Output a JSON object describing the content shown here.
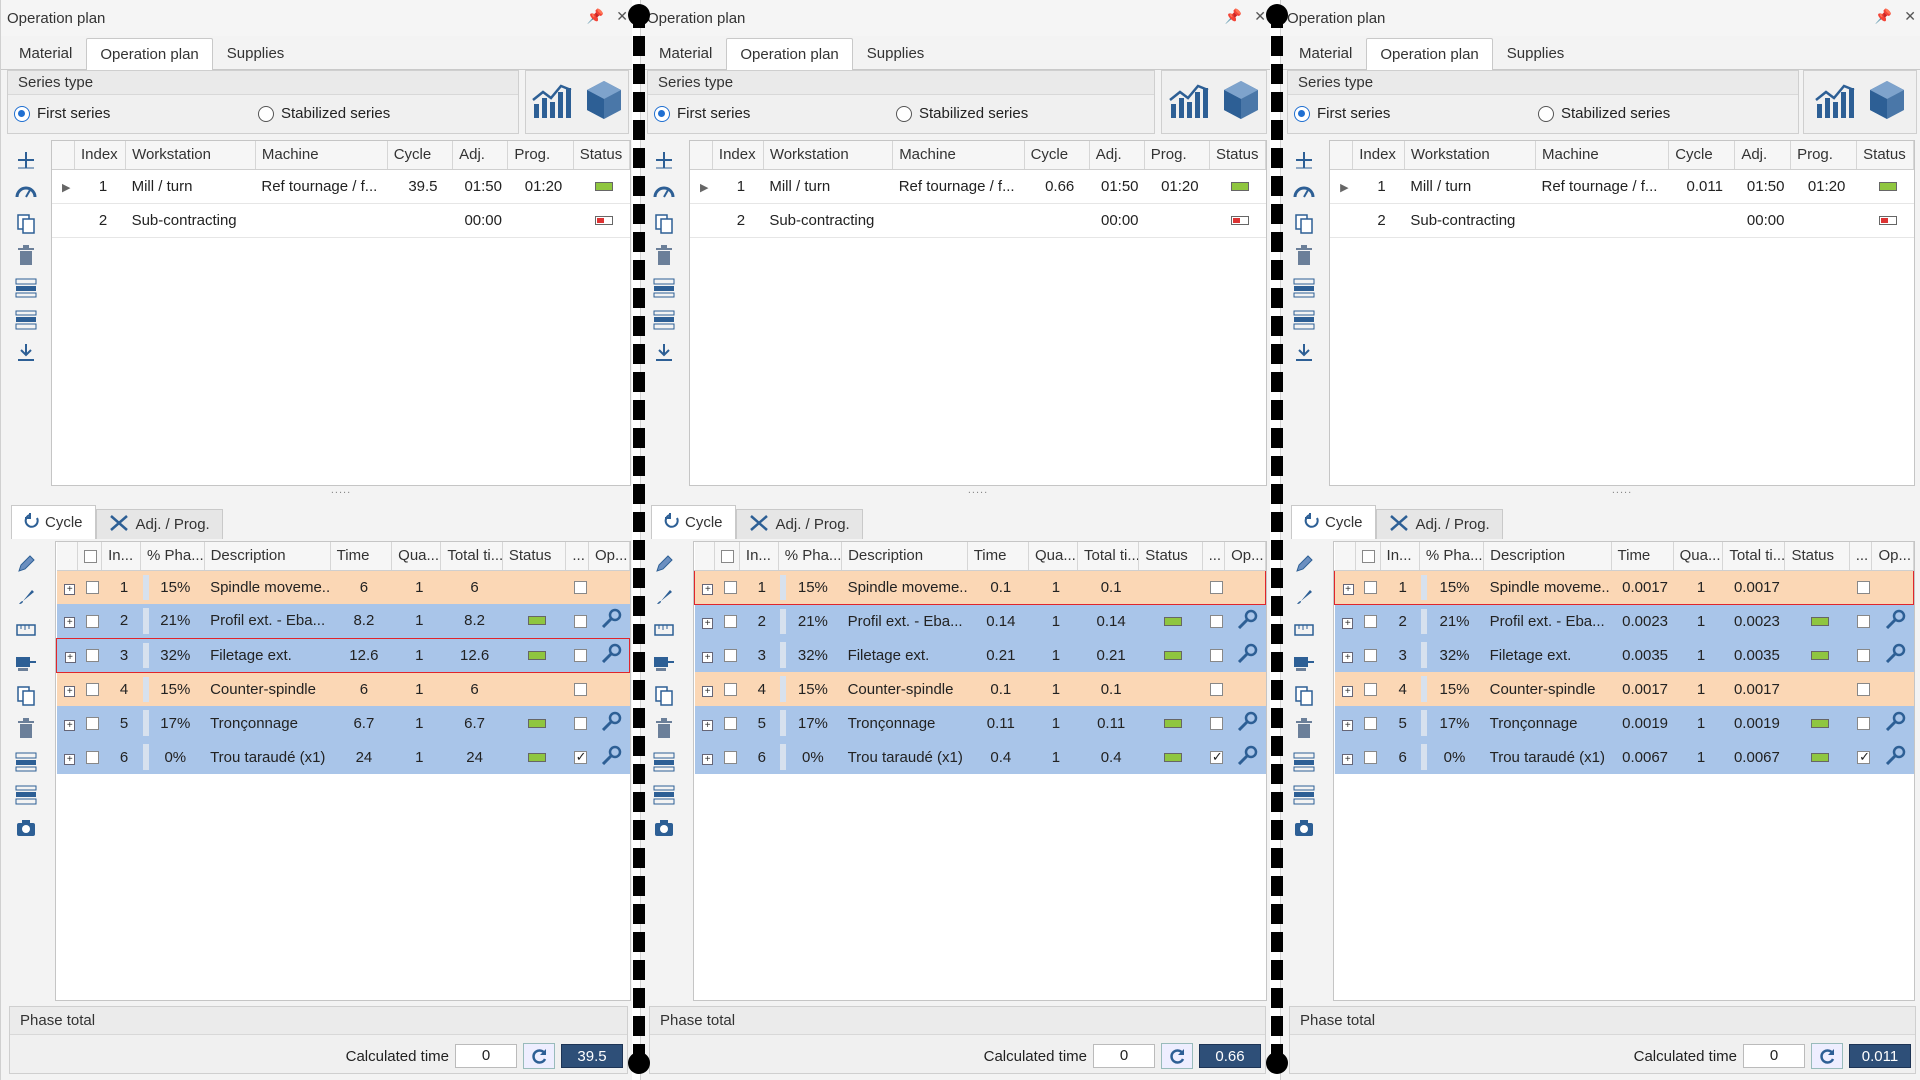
{
  "panels": [
    {
      "title": "Operation plan",
      "tabs": [
        "Material",
        "Operation plan",
        "Supplies"
      ],
      "active_tab": 1,
      "series_type": {
        "caption": "Series type",
        "options": [
          "First series",
          "Stabilized series"
        ],
        "selected": 0
      },
      "ops_columns": [
        "Index",
        "Workstation",
        "Machine",
        "Cycle",
        "Adj.",
        "Prog.",
        "Status"
      ],
      "ops_rows": [
        {
          "index": "1",
          "workstation": "Mill / turn",
          "machine": "Ref tournage / f...",
          "cycle": "39.5",
          "adj": "01:50",
          "prog": "01:20",
          "status": "green"
        },
        {
          "index": "2",
          "workstation": "Sub-contracting",
          "machine": "",
          "cycle": "",
          "adj": "00:00",
          "prog": "",
          "status": "red"
        }
      ],
      "sub_tabs": [
        "Cycle",
        "Adj. / Prog."
      ],
      "phase_columns": [
        "In...",
        "% Pha...",
        "Description",
        "Time",
        "Qua...",
        "Total ti...",
        "Status",
        "...",
        "Op..."
      ],
      "phase_rows": [
        {
          "index": "1",
          "pct": "15%",
          "desc": "Spindle moveme...",
          "time": "6",
          "qty": "1",
          "total": "6",
          "color": "orange",
          "status": "",
          "checked": false,
          "op": false,
          "selected": false
        },
        {
          "index": "2",
          "pct": "21%",
          "desc": "Profil ext. - Eba...",
          "time": "8.2",
          "qty": "1",
          "total": "8.2",
          "color": "blue",
          "status": "green",
          "checked": false,
          "op": true,
          "selected": false
        },
        {
          "index": "3",
          "pct": "32%",
          "desc": "Filetage ext.",
          "time": "12.6",
          "qty": "1",
          "total": "12.6",
          "color": "blue",
          "status": "green",
          "checked": false,
          "op": true,
          "selected": true
        },
        {
          "index": "4",
          "pct": "15%",
          "desc": "Counter-spindle",
          "time": "6",
          "qty": "1",
          "total": "6",
          "color": "orange",
          "status": "",
          "checked": false,
          "op": false,
          "selected": false
        },
        {
          "index": "5",
          "pct": "17%",
          "desc": "Tronçonnage",
          "time": "6.7",
          "qty": "1",
          "total": "6.7",
          "color": "blue",
          "status": "green",
          "checked": false,
          "op": true,
          "selected": false
        },
        {
          "index": "6",
          "pct": "0%",
          "desc": "Trou taraudé (x1)",
          "time": "24",
          "qty": "1",
          "total": "24",
          "color": "blue",
          "status": "green",
          "checked": true,
          "op": true,
          "selected": false
        }
      ],
      "footer": {
        "caption": "Phase total",
        "calc_label": "Calculated time",
        "calc_input": "0",
        "calc_result": "39.5"
      }
    },
    {
      "title": "Operation plan",
      "tabs": [
        "Material",
        "Operation plan",
        "Supplies"
      ],
      "active_tab": 1,
      "series_type": {
        "caption": "Series type",
        "options": [
          "First series",
          "Stabilized series"
        ],
        "selected": 0
      },
      "ops_columns": [
        "Index",
        "Workstation",
        "Machine",
        "Cycle",
        "Adj.",
        "Prog.",
        "Status"
      ],
      "ops_rows": [
        {
          "index": "1",
          "workstation": "Mill / turn",
          "machine": "Ref tournage / f...",
          "cycle": "0.66",
          "adj": "01:50",
          "prog": "01:20",
          "status": "green"
        },
        {
          "index": "2",
          "workstation": "Sub-contracting",
          "machine": "",
          "cycle": "",
          "adj": "00:00",
          "prog": "",
          "status": "red"
        }
      ],
      "sub_tabs": [
        "Cycle",
        "Adj. / Prog."
      ],
      "phase_columns": [
        "In...",
        "% Pha...",
        "Description",
        "Time",
        "Qua...",
        "Total ti...",
        "Status",
        "...",
        "Op..."
      ],
      "phase_rows": [
        {
          "index": "1",
          "pct": "15%",
          "desc": "Spindle moveme...",
          "time": "0.1",
          "qty": "1",
          "total": "0.1",
          "color": "orange",
          "status": "",
          "checked": false,
          "op": false,
          "selected": true
        },
        {
          "index": "2",
          "pct": "21%",
          "desc": "Profil ext. - Eba...",
          "time": "0.14",
          "qty": "1",
          "total": "0.14",
          "color": "blue",
          "status": "green",
          "checked": false,
          "op": true,
          "selected": false
        },
        {
          "index": "3",
          "pct": "32%",
          "desc": "Filetage ext.",
          "time": "0.21",
          "qty": "1",
          "total": "0.21",
          "color": "blue",
          "status": "green",
          "checked": false,
          "op": true,
          "selected": false
        },
        {
          "index": "4",
          "pct": "15%",
          "desc": "Counter-spindle",
          "time": "0.1",
          "qty": "1",
          "total": "0.1",
          "color": "orange",
          "status": "",
          "checked": false,
          "op": false,
          "selected": false
        },
        {
          "index": "5",
          "pct": "17%",
          "desc": "Tronçonnage",
          "time": "0.11",
          "qty": "1",
          "total": "0.11",
          "color": "blue",
          "status": "green",
          "checked": false,
          "op": true,
          "selected": false
        },
        {
          "index": "6",
          "pct": "0%",
          "desc": "Trou taraudé (x1)",
          "time": "0.4",
          "qty": "1",
          "total": "0.4",
          "color": "blue",
          "status": "green",
          "checked": true,
          "op": true,
          "selected": false
        }
      ],
      "footer": {
        "caption": "Phase total",
        "calc_label": "Calculated time",
        "calc_input": "0",
        "calc_result": "0.66"
      }
    },
    {
      "title": "Operation plan",
      "tabs": [
        "Material",
        "Operation plan",
        "Supplies"
      ],
      "active_tab": 1,
      "series_type": {
        "caption": "Series type",
        "options": [
          "First series",
          "Stabilized series"
        ],
        "selected": 0
      },
      "ops_columns": [
        "Index",
        "Workstation",
        "Machine",
        "Cycle",
        "Adj.",
        "Prog.",
        "Status"
      ],
      "ops_rows": [
        {
          "index": "1",
          "workstation": "Mill / turn",
          "machine": "Ref tournage / f...",
          "cycle": "0.011",
          "adj": "01:50",
          "prog": "01:20",
          "status": "green"
        },
        {
          "index": "2",
          "workstation": "Sub-contracting",
          "machine": "",
          "cycle": "",
          "adj": "00:00",
          "prog": "",
          "status": "red"
        }
      ],
      "sub_tabs": [
        "Cycle",
        "Adj. / Prog."
      ],
      "phase_columns": [
        "In...",
        "% Pha...",
        "Description",
        "Time",
        "Qua...",
        "Total ti...",
        "Status",
        "...",
        "Op..."
      ],
      "phase_rows": [
        {
          "index": "1",
          "pct": "15%",
          "desc": "Spindle moveme...",
          "time": "0.0017",
          "qty": "1",
          "total": "0.0017",
          "color": "orange",
          "status": "",
          "checked": false,
          "op": false,
          "selected": true
        },
        {
          "index": "2",
          "pct": "21%",
          "desc": "Profil ext. - Eba...",
          "time": "0.0023",
          "qty": "1",
          "total": "0.0023",
          "color": "blue",
          "status": "green",
          "checked": false,
          "op": true,
          "selected": false
        },
        {
          "index": "3",
          "pct": "32%",
          "desc": "Filetage ext.",
          "time": "0.0035",
          "qty": "1",
          "total": "0.0035",
          "color": "blue",
          "status": "green",
          "checked": false,
          "op": true,
          "selected": false
        },
        {
          "index": "4",
          "pct": "15%",
          "desc": "Counter-spindle",
          "time": "0.0017",
          "qty": "1",
          "total": "0.0017",
          "color": "orange",
          "status": "",
          "checked": false,
          "op": false,
          "selected": false
        },
        {
          "index": "5",
          "pct": "17%",
          "desc": "Tronçonnage",
          "time": "0.0019",
          "qty": "1",
          "total": "0.0019",
          "color": "blue",
          "status": "green",
          "checked": false,
          "op": true,
          "selected": false
        },
        {
          "index": "6",
          "pct": "0%",
          "desc": "Trou taraudé (x1)",
          "time": "0.0067",
          "qty": "1",
          "total": "0.0067",
          "color": "blue",
          "status": "green",
          "checked": true,
          "op": true,
          "selected": false
        }
      ],
      "footer": {
        "caption": "Phase total",
        "calc_label": "Calculated time",
        "calc_input": "0",
        "calc_result": "0.011"
      }
    }
  ],
  "colors": {
    "orange_row": "#fbd7b5",
    "blue_row": "#a9c5e9",
    "selected_border": "#e0252b",
    "accent": "#1f6fd1",
    "result_bg": "#2e4f78"
  }
}
